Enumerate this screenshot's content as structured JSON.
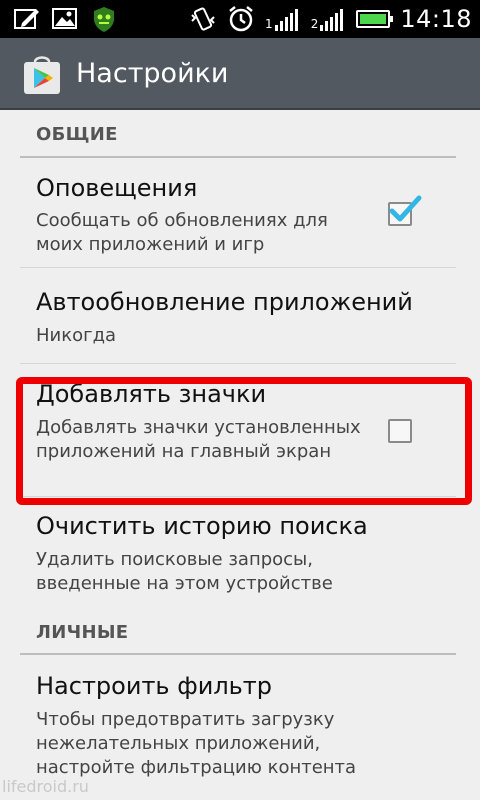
{
  "status_bar": {
    "time": "14:18",
    "network_labels": [
      "1",
      "2"
    ],
    "battery_level": 1.0,
    "icons": [
      "edit-icon",
      "gallery-icon",
      "android-robot-icon",
      "vibrate-icon",
      "alarm-icon",
      "signal-icon",
      "signal-icon",
      "battery-icon"
    ]
  },
  "action_bar": {
    "title": "Настройки",
    "app_icon": "play-store-icon"
  },
  "sections": {
    "general": "ОБЩИЕ",
    "personal": "ЛИЧНЫЕ"
  },
  "items": [
    {
      "title": "Оповещения",
      "summary": "Сообщать об обновлениях для моих приложений и игр",
      "checked": true
    },
    {
      "title": "Автообновление приложений",
      "summary": "Никогда"
    },
    {
      "title": "Добавлять значки",
      "summary": "Добавлять значки установленных приложений на главный экран",
      "checked": false
    },
    {
      "title": "Очистить историю поиска",
      "summary": "Удалить поисковые запросы, введенные на этом устройстве"
    },
    {
      "title": "Настроить фильтр",
      "summary": "Чтобы предотвратить загрузку нежелательных приложений, настройте фильтрацию контента"
    }
  ],
  "colors": {
    "highlight": "#ef0000",
    "checkmark": "#33b5e5",
    "battery": "#4cd74c",
    "action_bar": "#535960"
  },
  "watermark": "lifedroid.ru"
}
